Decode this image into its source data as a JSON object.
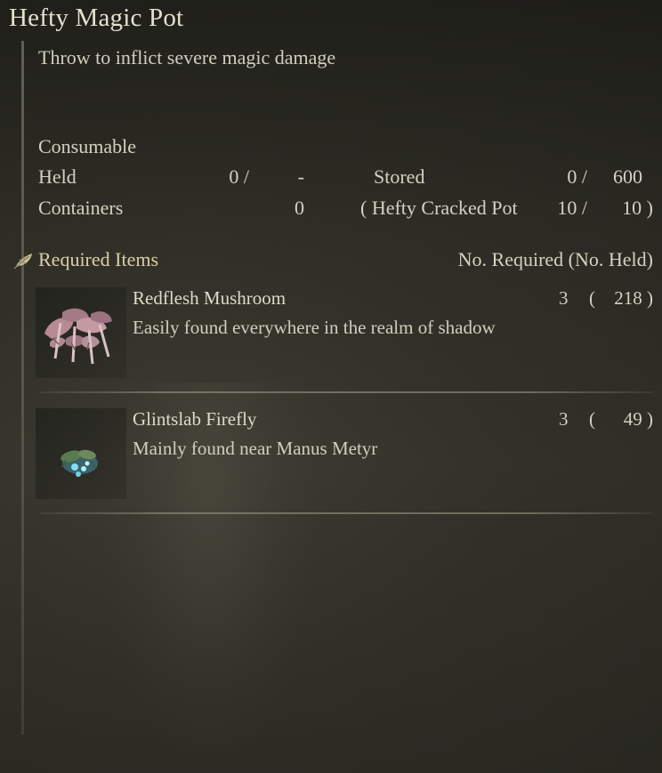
{
  "item": {
    "name": "Hefty Magic Pot",
    "description": "Throw to inflict severe magic damage",
    "category": "Consumable"
  },
  "stats": {
    "held_label": "Held",
    "held_value": "0 /",
    "held_max": "-",
    "stored_label": "Stored",
    "stored_value": "0 /",
    "stored_max": "600",
    "containers_label": "Containers",
    "containers_value": "0",
    "container_name": "( Hefty Cracked Pot",
    "container_held": "10 /",
    "container_max": "10 )"
  },
  "required": {
    "title": "Required Items",
    "column_label": "No. Required (No. Held)",
    "icon": "leaf-icon",
    "items": [
      {
        "name": "Redflesh Mushroom",
        "description": "Easily found everywhere in the realm of shadow",
        "required": "3",
        "open": "(",
        "held": "218 )",
        "icon": "mushroom-icon"
      },
      {
        "name": "Glintslab Firefly",
        "description": "Mainly found near Manus Metyr",
        "required": "3",
        "open": "(",
        "held": "49 )",
        "icon": "firefly-icon"
      }
    ]
  },
  "colors": {
    "background": "#33322a",
    "text": "#d8d4c4",
    "accent": "#d8cfa8"
  }
}
